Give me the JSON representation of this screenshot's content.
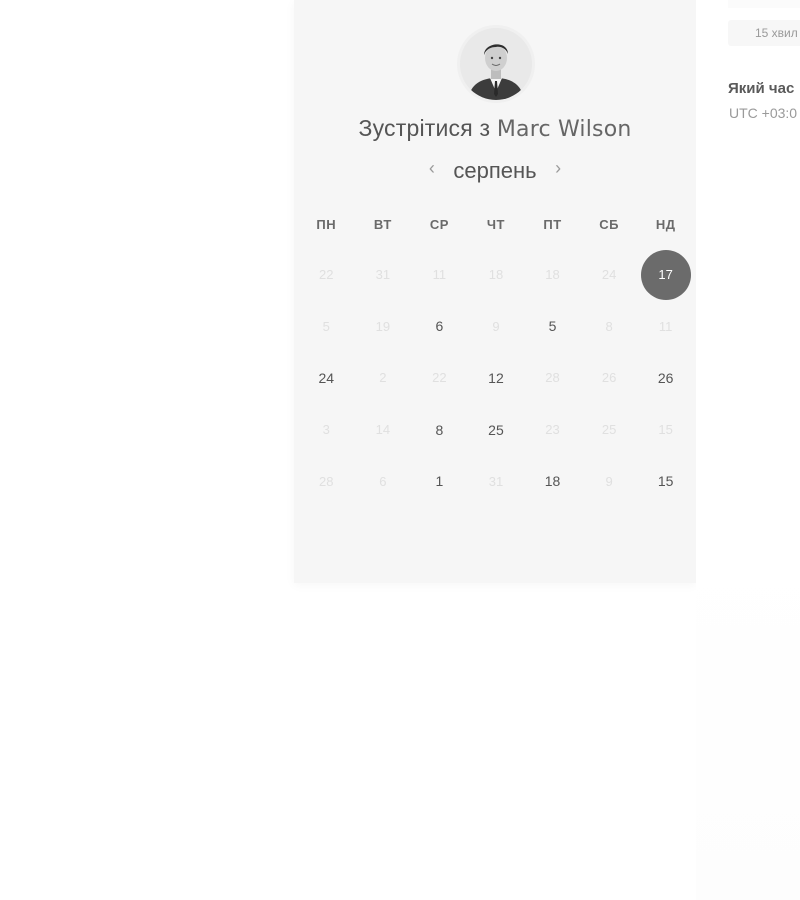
{
  "host": {
    "heading_prefix": "Зустрітися з",
    "name": "Marc Wilson"
  },
  "calendar": {
    "month": "серпень",
    "prev_icon": "chevron-left-icon",
    "next_icon": "chevron-right-icon",
    "weekdays": [
      "ПН",
      "ВТ",
      "СР",
      "ЧТ",
      "ПТ",
      "СБ",
      "НД"
    ],
    "weeks": [
      [
        {
          "label": "22",
          "state": "muted"
        },
        {
          "label": "31",
          "state": "muted"
        },
        {
          "label": "11",
          "state": "muted"
        },
        {
          "label": "18",
          "state": "muted"
        },
        {
          "label": "18",
          "state": "muted"
        },
        {
          "label": "24",
          "state": "muted"
        },
        {
          "label": "17",
          "state": "selected"
        }
      ],
      [
        {
          "label": "5",
          "state": "muted"
        },
        {
          "label": "19",
          "state": "muted"
        },
        {
          "label": "6",
          "state": "active"
        },
        {
          "label": "9",
          "state": "muted"
        },
        {
          "label": "5",
          "state": "active"
        },
        {
          "label": "8",
          "state": "muted"
        },
        {
          "label": "11",
          "state": "muted"
        }
      ],
      [
        {
          "label": "24",
          "state": "active"
        },
        {
          "label": "2",
          "state": "muted"
        },
        {
          "label": "22",
          "state": "muted"
        },
        {
          "label": "12",
          "state": "active"
        },
        {
          "label": "28",
          "state": "muted"
        },
        {
          "label": "26",
          "state": "muted"
        },
        {
          "label": "26",
          "state": "active"
        }
      ],
      [
        {
          "label": "3",
          "state": "muted"
        },
        {
          "label": "14",
          "state": "muted"
        },
        {
          "label": "8",
          "state": "active"
        },
        {
          "label": "25",
          "state": "active"
        },
        {
          "label": "23",
          "state": "muted"
        },
        {
          "label": "25",
          "state": "muted"
        },
        {
          "label": "15",
          "state": "muted"
        }
      ],
      [
        {
          "label": "28",
          "state": "muted"
        },
        {
          "label": "6",
          "state": "muted"
        },
        {
          "label": "1",
          "state": "active"
        },
        {
          "label": "31",
          "state": "muted"
        },
        {
          "label": "18",
          "state": "active"
        },
        {
          "label": "9",
          "state": "muted"
        },
        {
          "label": "15",
          "state": "active"
        }
      ]
    ]
  },
  "side_panel": {
    "duration": "15 хвил",
    "tz_question": "Який час",
    "tz_value": "UTC +03:0"
  },
  "colors": {
    "panel_bg": "#f6f6f6",
    "selected_day_bg": "#6b6b6b",
    "muted_day": "#e0e0e0",
    "active_day": "#555555"
  }
}
